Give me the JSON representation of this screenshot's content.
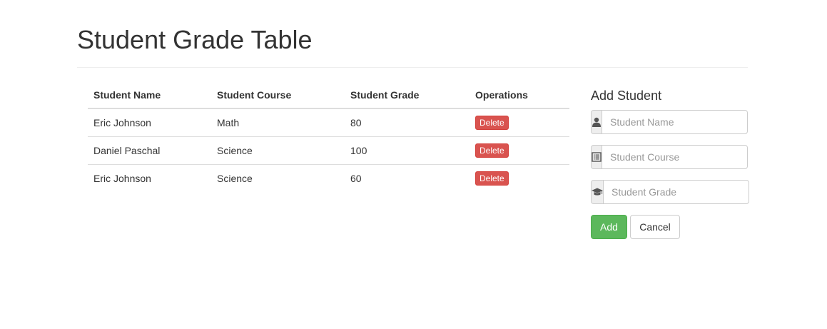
{
  "header": {
    "title": "Student Grade Table"
  },
  "table": {
    "columns": [
      "Student Name",
      "Student Course",
      "Student Grade",
      "Operations"
    ],
    "rows": [
      {
        "name": "Eric Johnson",
        "course": "Math",
        "grade": "80",
        "action": "Delete"
      },
      {
        "name": "Daniel Paschal",
        "course": "Science",
        "grade": "100",
        "action": "Delete"
      },
      {
        "name": "Eric Johnson",
        "course": "Science",
        "grade": "60",
        "action": "Delete"
      }
    ]
  },
  "form": {
    "title": "Add Student",
    "name_placeholder": "Student Name",
    "name_value": "",
    "name_icon": "user-icon",
    "course_placeholder": "Student Course",
    "course_value": "",
    "course_icon": "list-alt-icon",
    "grade_placeholder": "Student Grade",
    "grade_value": "",
    "grade_icon": "graduation-cap-icon",
    "add_label": "Add",
    "cancel_label": "Cancel"
  },
  "colors": {
    "danger": "#d9534f",
    "success": "#5cb85c",
    "addon_bg": "#eeeeee"
  }
}
